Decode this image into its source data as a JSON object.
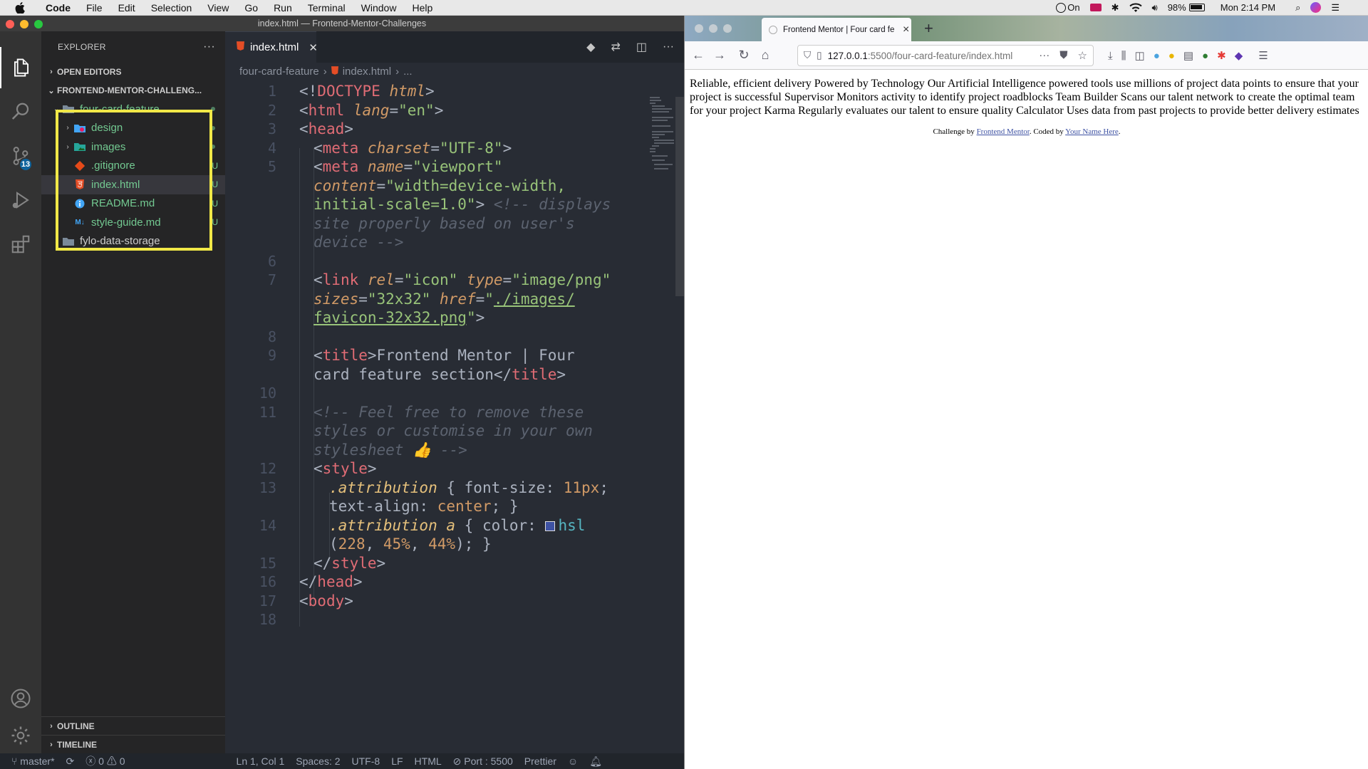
{
  "menubar": {
    "items": [
      "Code",
      "File",
      "Edit",
      "Selection",
      "View",
      "Go",
      "Run",
      "Terminal",
      "Window",
      "Help"
    ],
    "status": {
      "accessibility": "On",
      "battery": "98%",
      "clock": "Mon 2:14 PM"
    }
  },
  "vscode": {
    "window_title": "index.html — Frontend-Mentor-Challenges",
    "scm_badge": "13",
    "explorer": {
      "title": "EXPLORER",
      "open_editors": "OPEN EDITORS",
      "workspace": "FRONTEND-MENTOR-CHALLENG...",
      "tree": [
        {
          "name": "four-card-feature",
          "type": "folder-open",
          "status": "dot"
        },
        {
          "name": "design",
          "type": "folder",
          "status": "dot"
        },
        {
          "name": "images",
          "type": "folder",
          "status": "dot"
        },
        {
          "name": ".gitignore",
          "type": "git",
          "status": "U"
        },
        {
          "name": "index.html",
          "type": "html",
          "status": "U"
        },
        {
          "name": "README.md",
          "type": "info",
          "status": "U"
        },
        {
          "name": "style-guide.md",
          "type": "markdown",
          "status": "U"
        },
        {
          "name": "fylo-data-storage",
          "type": "folder",
          "status": ""
        }
      ],
      "outline": "OUTLINE",
      "timeline": "TIMELINE"
    },
    "tab": {
      "label": "index.html"
    },
    "breadcrumbs": [
      "four-card-feature",
      "index.html",
      "..."
    ],
    "line_numbers": [
      "1",
      "2",
      "3",
      "4",
      "5",
      "",
      "",
      "",
      "6",
      "7",
      "",
      "",
      "8",
      "9",
      "",
      "10",
      "11",
      "",
      "",
      "12",
      "13",
      "",
      "14",
      "",
      "15",
      "16",
      "17",
      "18"
    ],
    "code": [
      [
        "<!",
        "DOCTYPE",
        " html",
        ">"
      ],
      [
        "<",
        "html",
        " lang",
        "=",
        "\"en\"",
        ">"
      ],
      [
        "<",
        "head",
        ">"
      ],
      [
        "<",
        "meta",
        " charset",
        "=",
        "\"UTF-8\"",
        ">"
      ],
      [
        "<",
        "meta",
        " name",
        "=",
        "\"viewport\""
      ],
      [
        "content",
        "=",
        "\"width=device-width,"
      ],
      [
        "initial-scale=1.0\"",
        ">",
        " <!-- displays"
      ],
      [
        "site properly based on user's"
      ],
      [
        "device -->"
      ],
      [],
      [
        "<",
        "link",
        " rel",
        "=",
        "\"icon\"",
        " type",
        "=",
        "\"image/png\""
      ],
      [
        "sizes",
        "=",
        "\"32x32\"",
        " href",
        "=",
        "\"",
        "./images/"
      ],
      [
        "favicon-32x32.png",
        "\"",
        ">"
      ],
      [],
      [
        "<",
        "title",
        ">",
        "Frontend Mentor | Four"
      ],
      [
        "card feature section",
        "</",
        "title",
        ">"
      ],
      [],
      [
        "<!-- Feel free to remove these"
      ],
      [
        "styles or customise in your own"
      ],
      [
        "stylesheet 👍 -->"
      ],
      [
        "<",
        "style",
        ">"
      ],
      [
        ".attribution",
        " { ",
        "font-size",
        ": ",
        "11px",
        ";"
      ],
      [
        "text-align",
        ": ",
        "center",
        "; }"
      ],
      [
        ".attribution",
        " a",
        " { ",
        "color",
        ": ",
        "hsl"
      ],
      [
        "(",
        "228",
        ", ",
        "45%",
        ", ",
        "44%",
        "); }"
      ],
      [
        "</",
        "style",
        ">"
      ],
      [
        "</",
        "head",
        ">"
      ],
      [
        "<",
        "body",
        ">"
      ]
    ],
    "status_bar": {
      "branch": "master*",
      "errors": "0",
      "warnings": "0",
      "position": "Ln 1, Col 1",
      "spaces": "Spaces: 2",
      "encoding": "UTF-8",
      "eol": "LF",
      "language": "HTML",
      "port": "Port : 5500",
      "formatter": "Prettier"
    }
  },
  "browser": {
    "tab_title": "Frontend Mentor | Four card fe",
    "url_host": "127.0.0.1",
    "url_path": ":5500/four-card-feature/index.html",
    "page_text": "Reliable, efficient delivery Powered by Technology Our Artificial Intelligence powered tools use millions of project data points to ensure that your project is successful Supervisor Monitors activity to identify project roadblocks Team Builder Scans our talent network to create the optimal team for your project Karma Regularly evaluates our talent to ensure quality Calculator Uses data from past projects to provide better delivery estimates",
    "attribution": {
      "prefix": "Challenge by ",
      "link1": "Frontend Mentor",
      "middle": ". Coded by ",
      "link2": "Your Name Here",
      "suffix": "."
    }
  }
}
